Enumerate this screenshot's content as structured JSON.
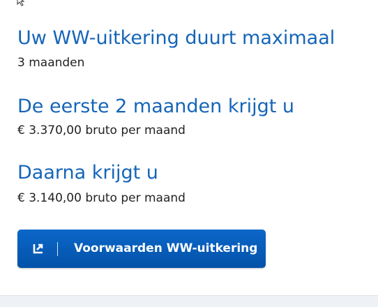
{
  "duration": {
    "heading": "Uw WW-uitkering duurt maximaal",
    "value": "3 maanden"
  },
  "first_period": {
    "heading": "De eerste 2 maanden krijgt u",
    "value": "€ 3.370,00 bruto per maand"
  },
  "after_period": {
    "heading": "Daarna krijgt u",
    "value": "€ 3.140,00 bruto per maand"
  },
  "button": {
    "label": "Voorwaarden WW-uitkering",
    "icon": "external-link-icon"
  },
  "colors": {
    "heading": "#1565b8",
    "button": "#0a5fbf",
    "text": "#222222",
    "background": "#eef2f7"
  }
}
